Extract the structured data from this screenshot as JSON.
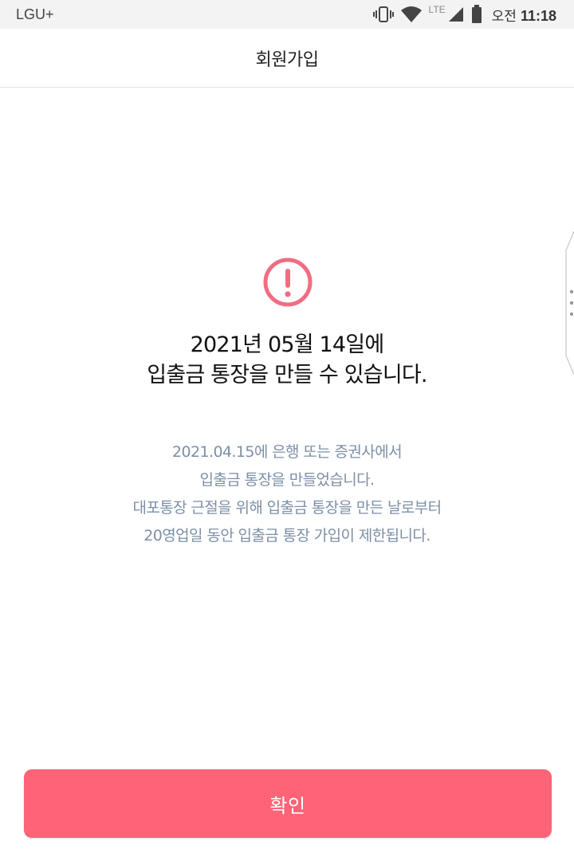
{
  "status_bar": {
    "carrier": "LGU+",
    "network_label": "LTE",
    "ampm": "오전",
    "time": "11:18",
    "icons": [
      "vibrate-icon",
      "wifi-icon",
      "signal-icon",
      "battery-icon"
    ]
  },
  "header": {
    "title": "회원가입"
  },
  "alert": {
    "icon": "exclamation-circle-icon",
    "accent_color": "#f06e82",
    "headline_lines": [
      "2021년 05월 14일에",
      "입출금 통장을 만들 수 있습니다."
    ],
    "detail_lines": [
      "2021.04.15에 은행 또는 증권사에서",
      "입출금 통장을 만들었습니다.",
      "대포통장 근절을 위해 입출금 통장을 만든 날로부터",
      "20영업일 동안 입출금 통장 가입이 제한됩니다."
    ]
  },
  "footer": {
    "confirm_label": "확인",
    "button_color": "#ff6378"
  }
}
